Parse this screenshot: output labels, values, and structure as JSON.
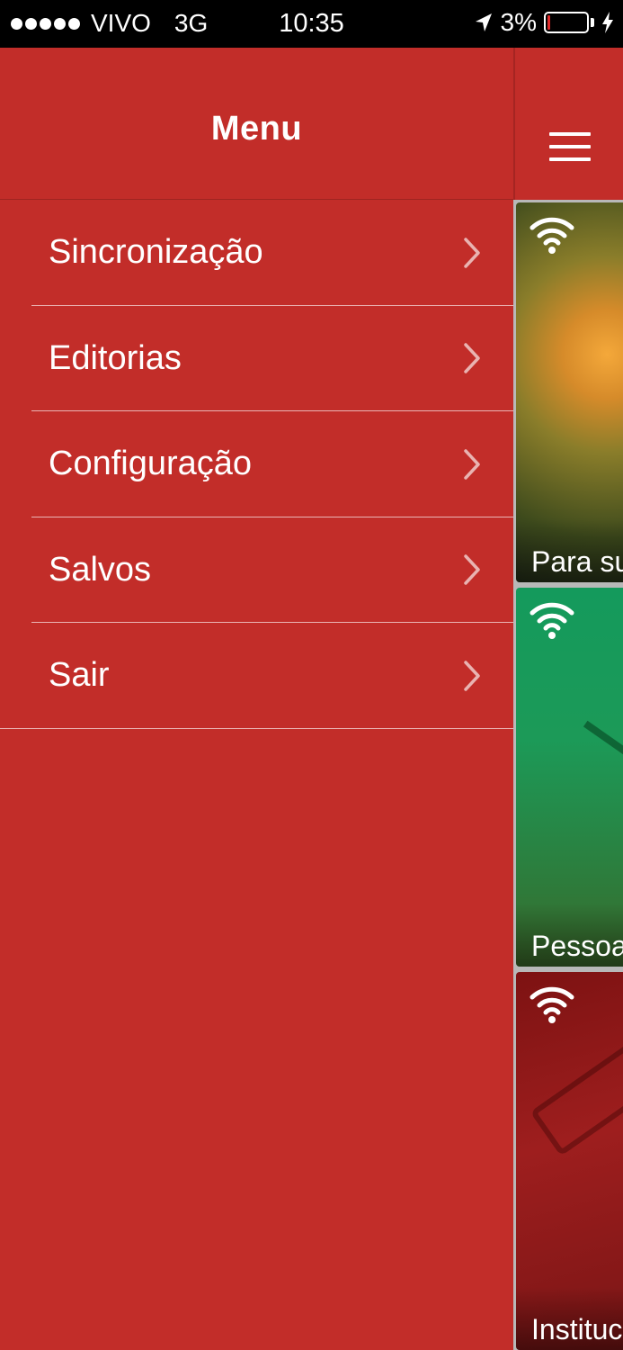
{
  "status_bar": {
    "carrier": "VIVO",
    "network": "3G",
    "time": "10:35",
    "battery": "3%",
    "battery_level": 0.03
  },
  "drawer": {
    "title": "Menu",
    "items": [
      {
        "label": "Sincronização"
      },
      {
        "label": "Editorias"
      },
      {
        "label": "Configuração"
      },
      {
        "label": "Salvos"
      },
      {
        "label": "Sair"
      }
    ]
  },
  "cards": [
    {
      "title": "Para su"
    },
    {
      "title": "Pessoa"
    },
    {
      "title": "Instituc"
    }
  ],
  "colors": {
    "accent": "#c22d29",
    "status_bar": "#000000"
  },
  "icons": {
    "menu": "hamburger-icon",
    "chevron": "chevron-right-icon",
    "online": "wifi-icon",
    "location": "location-arrow-icon",
    "charging": "charging-bolt-icon"
  }
}
